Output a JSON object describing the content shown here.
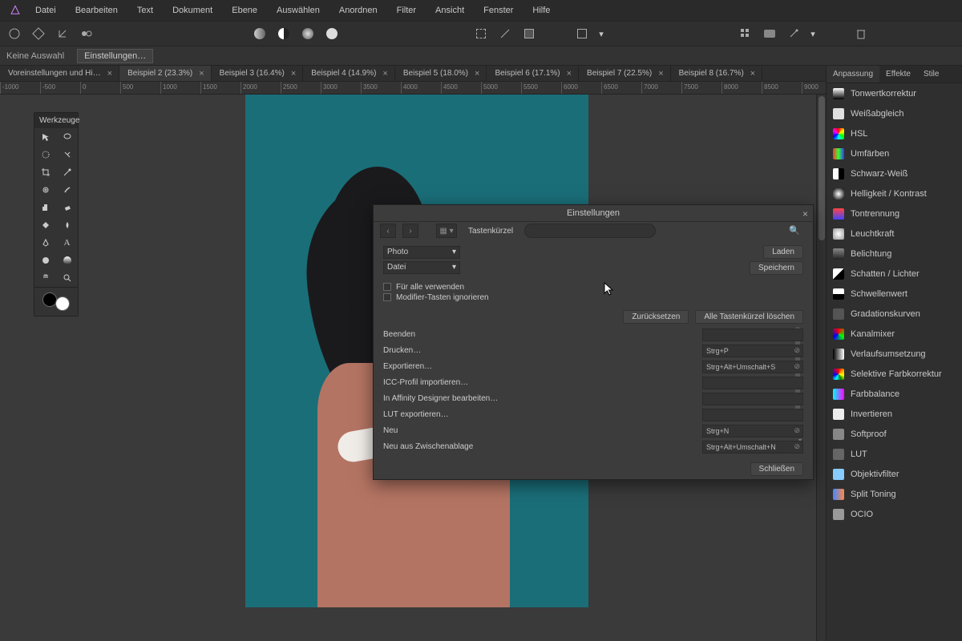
{
  "menu": {
    "items": [
      "Datei",
      "Bearbeiten",
      "Text",
      "Dokument",
      "Ebene",
      "Auswählen",
      "Anordnen",
      "Filter",
      "Ansicht",
      "Fenster",
      "Hilfe"
    ]
  },
  "context": {
    "status": "Keine Auswahl",
    "chip": "Einstellungen…"
  },
  "tabs": [
    {
      "label": "Voreinstellungen und Hi…"
    },
    {
      "label": "Beispiel 2 (23.3%)"
    },
    {
      "label": "Beispiel 3 (16.4%)"
    },
    {
      "label": "Beispiel 4 (14.9%)"
    },
    {
      "label": "Beispiel 5 (18.0%)"
    },
    {
      "label": "Beispiel 6 (17.1%)"
    },
    {
      "label": "Beispiel 7 (22.5%)"
    },
    {
      "label": "Beispiel 8 (16.7%)"
    }
  ],
  "tools": {
    "title": "Werkzeuge"
  },
  "rpanel": {
    "tabs": [
      "Anpassung",
      "Effekte",
      "Stile"
    ],
    "adjustments": [
      {
        "label": "Tonwertkorrektur",
        "color": "linear-gradient(#fff,#000)"
      },
      {
        "label": "Weißabgleich",
        "color": "#e0e0e0"
      },
      {
        "label": "HSL",
        "color": "conic-gradient(red,yellow,lime,cyan,blue,magenta,red)"
      },
      {
        "label": "Umfärben",
        "color": "linear-gradient(90deg,#f33,#3f3,#33f)"
      },
      {
        "label": "Schwarz-Weiß",
        "color": "linear-gradient(90deg,#fff 50%,#000 50%)"
      },
      {
        "label": "Helligkeit / Kontrast",
        "color": "radial-gradient(#fff,#000)"
      },
      {
        "label": "Tontrennung",
        "color": "linear-gradient(#f44,#44f)"
      },
      {
        "label": "Leuchtkraft",
        "color": "radial-gradient(#fff,#999)"
      },
      {
        "label": "Belichtung",
        "color": "linear-gradient(#888,#222)"
      },
      {
        "label": "Schatten / Lichter",
        "color": "linear-gradient(135deg,#fff 50%,#000 50%)"
      },
      {
        "label": "Schwellenwert",
        "color": "linear-gradient(#fff 50%,#000 50%)"
      },
      {
        "label": "Gradationskurven",
        "color": "#555"
      },
      {
        "label": "Kanalmixer",
        "color": "conic-gradient(#f00,#0f0,#00f,#f00)"
      },
      {
        "label": "Verlaufsumsetzung",
        "color": "linear-gradient(90deg,#000,#fff)"
      },
      {
        "label": "Selektive Farbkorrektur",
        "color": "conic-gradient(red,orange,yellow,green,cyan,blue,purple,red)"
      },
      {
        "label": "Farbbalance",
        "color": "linear-gradient(90deg,#0ff,#f0f)"
      },
      {
        "label": "Invertieren",
        "color": "#eee"
      },
      {
        "label": "Softproof",
        "color": "#888"
      },
      {
        "label": "LUT",
        "color": "#666"
      },
      {
        "label": "Objektivfilter",
        "color": "#8cf"
      },
      {
        "label": "Split Toning",
        "color": "linear-gradient(90deg,#48f,#f84)"
      },
      {
        "label": "OCIO",
        "color": "#999"
      }
    ]
  },
  "dialog": {
    "title": "Einstellungen",
    "section": "Tastenkürzel",
    "dropdown1": "Photo",
    "dropdown2": "Datei",
    "load": "Laden",
    "save": "Speichern",
    "opt1": "Für alle verwenden",
    "opt2": "Modifier-Tasten ignorieren",
    "reset": "Zurücksetzen",
    "clearall": "Alle Tastenkürzel löschen",
    "close": "Schließen",
    "rows": [
      {
        "name": "Beenden",
        "kb": ""
      },
      {
        "name": "Drucken…",
        "kb": "Strg+P"
      },
      {
        "name": "Exportieren…",
        "kb": "Strg+Alt+Umschalt+S"
      },
      {
        "name": "ICC-Profil importieren…",
        "kb": ""
      },
      {
        "name": "In Affinity Designer bearbeiten…",
        "kb": ""
      },
      {
        "name": "LUT exportieren…",
        "kb": ""
      },
      {
        "name": "Neu",
        "kb": "Strg+N"
      },
      {
        "name": "Neu aus Zwischenablage",
        "kb": "Strg+Alt+Umschalt+N"
      }
    ]
  },
  "ruler": [
    "-1000",
    "-500",
    "0",
    "500",
    "1000",
    "1500",
    "2000",
    "2500",
    "3000",
    "3500",
    "4000",
    "4500",
    "5000",
    "5500",
    "6000",
    "6500",
    "7000",
    "7500",
    "8000",
    "8500",
    "9000"
  ]
}
